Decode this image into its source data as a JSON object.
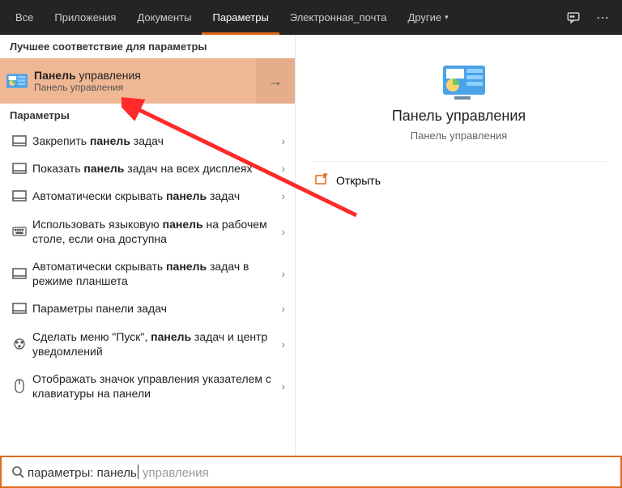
{
  "tabs": {
    "all": "Все",
    "apps": "Приложения",
    "docs": "Документы",
    "params": "Параметры",
    "email": "Электронная_почта",
    "more": "Другие"
  },
  "left": {
    "best_header": "Лучшее соответствие для параметры",
    "best": {
      "pre": "Панель",
      "rest": " управления",
      "sub": "Панель управления"
    },
    "params_header": "Параметры",
    "items": [
      {
        "pre": "Закрепить ",
        "bold": "панель",
        "post": " задач"
      },
      {
        "pre": "Показать ",
        "bold": "панель",
        "post": " задач на всех дисплеях"
      },
      {
        "pre": "Автоматически скрывать ",
        "bold": "панель",
        "post": " задач"
      },
      {
        "pre": "Использовать языковую ",
        "bold": "панель",
        "post": " на рабочем столе, если она доступна"
      },
      {
        "pre": "Автоматически скрывать ",
        "bold": "панель",
        "post": " задач в режиме планшета"
      },
      {
        "pre": "Параметры панели задач",
        "bold": "",
        "post": ""
      },
      {
        "pre": "Сделать меню \"Пуск\", ",
        "bold": "панель",
        "post": " задач и центр уведомлений"
      },
      {
        "pre": "Отображать значок управления указателем с клавиатуры на панели",
        "bold": "",
        "post": ""
      }
    ]
  },
  "right": {
    "title": "Панель управления",
    "sub": "Панель управления",
    "open": "Открыть"
  },
  "search": {
    "prefix": "параметры: ",
    "typed": "панель",
    "ghost": " управления"
  }
}
